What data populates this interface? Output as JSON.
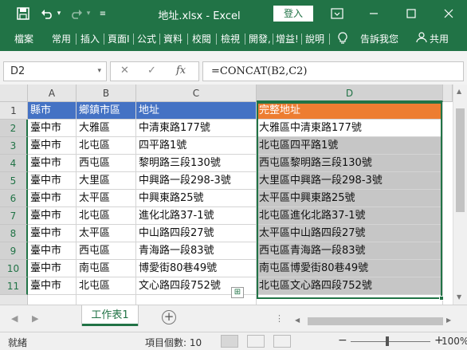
{
  "window": {
    "title": "地址.xlsx - Excel",
    "login_label": "登入",
    "save_icon": "save-icon",
    "undo_icon": "undo-icon",
    "redo_icon": "redo-icon",
    "qat_dropdown_icon": "dropdown-icon",
    "display_options_icon": "ribbon-display-icon",
    "minimize_icon": "minimize-icon",
    "maximize_icon": "maximize-icon",
    "close_icon": "close-icon"
  },
  "ribbon": {
    "tabs": [
      "檔案",
      "常用",
      "插入",
      "頁面I",
      "公式",
      "資料",
      "校閱",
      "檢視",
      "開發,",
      "增益!",
      "說明"
    ],
    "tell_me": "告訴我您",
    "share": "共用"
  },
  "formula_bar": {
    "name_box": "D2",
    "cancel": "✕",
    "enter": "✓",
    "fx": "fx",
    "formula": "=CONCAT(B2,C2)"
  },
  "grid": {
    "columns": [
      "A",
      "B",
      "C",
      "D"
    ],
    "rows": [
      [
        "縣市",
        "鄉鎮市區",
        "地址",
        "完整地址"
      ],
      [
        "臺中市",
        "大雅區",
        "中清東路177號",
        "大雅區中清東路177號"
      ],
      [
        "臺中市",
        "北屯區",
        "四平路1號",
        "北屯區四平路1號"
      ],
      [
        "臺中市",
        "西屯區",
        "黎明路三段130號",
        "西屯區黎明路三段130號"
      ],
      [
        "臺中市",
        "大里區",
        "中興路一段298-3號",
        "大里區中興路一段298-3號"
      ],
      [
        "臺中市",
        "太平區",
        "中興東路25號",
        "太平區中興東路25號"
      ],
      [
        "臺中市",
        "北屯區",
        "進化北路37-1號",
        "北屯區進化北路37-1號"
      ],
      [
        "臺中市",
        "太平區",
        "中山路四段27號",
        "太平區中山路四段27號"
      ],
      [
        "臺中市",
        "西屯區",
        "青海路一段83號",
        "西屯區青海路一段83號"
      ],
      [
        "臺中市",
        "南屯區",
        "博愛街80巷49號",
        "南屯區博愛街80巷49號"
      ],
      [
        "臺中市",
        "北屯區",
        "文心路四段752號",
        "北屯區文心路四段752號"
      ]
    ],
    "row_numbers": [
      "1",
      "2",
      "3",
      "4",
      "5",
      "6",
      "7",
      "8",
      "9",
      "10",
      "11"
    ],
    "header_colors": {
      "abc": "#4472c4",
      "d": "#ed7d31"
    },
    "selection_color": "#217346"
  },
  "sheets": {
    "tabs": [
      "工作表1"
    ],
    "add_icon": "plus-circle-icon"
  },
  "status": {
    "mode": "就緒",
    "count_label": "項目個數: 10",
    "zoom_minus": "−",
    "zoom_plus": "+",
    "zoom": "100%"
  }
}
